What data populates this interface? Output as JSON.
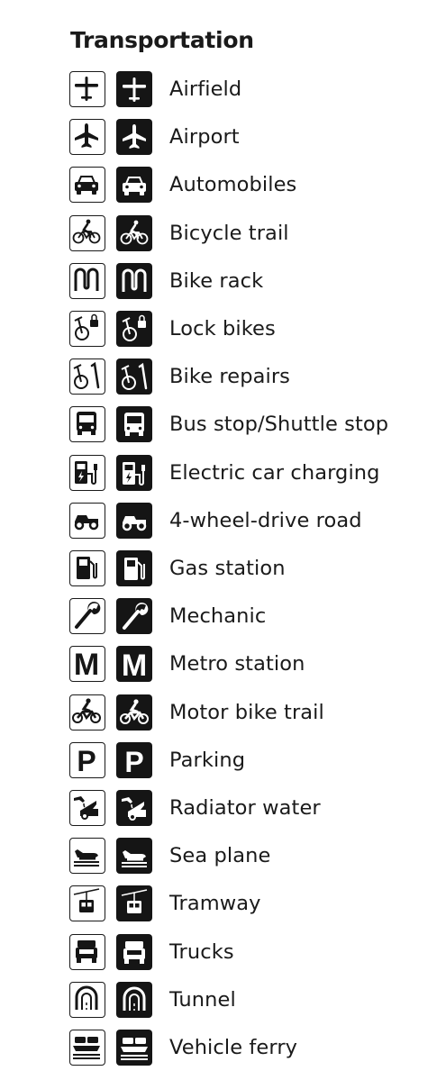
{
  "title": "Transportation",
  "symbols": [
    {
      "label": "Airfield",
      "icon": "airfield-icon"
    },
    {
      "label": "Airport",
      "icon": "airport-icon"
    },
    {
      "label": "Automobiles",
      "icon": "automobile-icon"
    },
    {
      "label": "Bicycle trail",
      "icon": "bicycle-icon"
    },
    {
      "label": "Bike rack",
      "icon": "bike-rack-icon"
    },
    {
      "label": "Lock bikes",
      "icon": "lock-bikes-icon"
    },
    {
      "label": "Bike repairs",
      "icon": "bike-repairs-icon"
    },
    {
      "label": "Bus stop/Shuttle stop",
      "icon": "bus-icon"
    },
    {
      "label": "Electric car charging",
      "icon": "ev-charging-icon"
    },
    {
      "label": "4-wheel-drive road",
      "icon": "four-wheel-drive-icon"
    },
    {
      "label": "Gas station",
      "icon": "gas-pump-icon"
    },
    {
      "label": "Mechanic",
      "icon": "wrench-icon"
    },
    {
      "label": "Metro station",
      "icon": "metro-m-icon"
    },
    {
      "label": "Motor bike trail",
      "icon": "motorbike-icon"
    },
    {
      "label": "Parking",
      "icon": "parking-p-icon"
    },
    {
      "label": "Radiator water",
      "icon": "radiator-water-icon"
    },
    {
      "label": "Sea plane",
      "icon": "sea-plane-icon"
    },
    {
      "label": "Tramway",
      "icon": "tramway-icon"
    },
    {
      "label": "Trucks",
      "icon": "truck-icon"
    },
    {
      "label": "Tunnel",
      "icon": "tunnel-icon"
    },
    {
      "label": "Vehicle ferry",
      "icon": "vehicle-ferry-icon"
    }
  ]
}
